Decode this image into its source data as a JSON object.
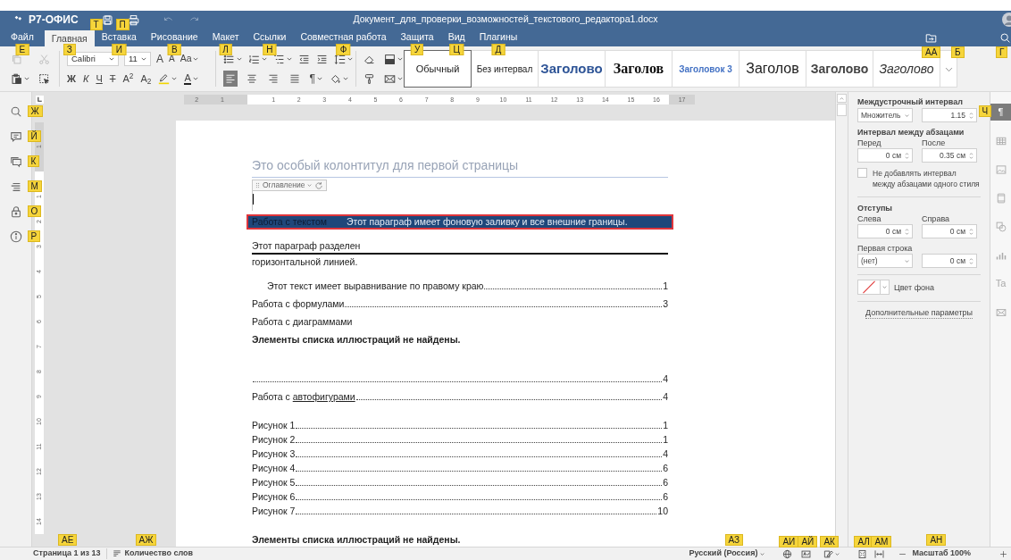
{
  "header": {
    "app_name": "Р7-ОФИС",
    "title": "Документ_для_проверки_возможностей_текстового_редактора1.docx",
    "quick_actions": [
      {
        "kind": "save",
        "hint": "Т",
        "disabled": false
      },
      {
        "kind": "print",
        "hint": "П",
        "disabled": false
      },
      {
        "kind": "undo",
        "disabled": true
      },
      {
        "kind": "redo",
        "disabled": true
      }
    ]
  },
  "tabs": [
    {
      "label": "Файл",
      "selected": false,
      "hint": "Е"
    },
    {
      "label": "Главная",
      "selected": true,
      "hint": "З"
    },
    {
      "label": "Вставка",
      "selected": false,
      "hint": "И"
    },
    {
      "label": "Рисование",
      "selected": false,
      "hint": "В"
    },
    {
      "label": "Макет",
      "selected": false,
      "hint": "Л"
    },
    {
      "label": "Ссылки",
      "selected": false,
      "hint": "Н"
    },
    {
      "label": "Совместная работа",
      "selected": false,
      "hint": "Ф"
    },
    {
      "label": "Защита",
      "selected": false,
      "hint": "У"
    },
    {
      "label": "Вид",
      "selected": false,
      "hint": "Ц"
    },
    {
      "label": "Плагины",
      "selected": false,
      "hint": "Д"
    }
  ],
  "header_actions": [
    {
      "kind": "open-location",
      "hint": "АА"
    },
    {
      "kind": "blank",
      "hint": "Б"
    },
    {
      "kind": "search",
      "hint": "Г"
    }
  ],
  "toolbar": {
    "clipboard": [
      {
        "kind": "copy",
        "disabled": true
      },
      {
        "kind": "cut",
        "disabled": true
      },
      {
        "kind": "paste",
        "disabled": false
      },
      {
        "kind": "select-all",
        "disabled": false
      }
    ],
    "font": "Calibri",
    "size": "11",
    "font_buttons": [
      {
        "kind": "grow",
        "label": "A"
      },
      {
        "kind": "shrink",
        "label": "A"
      },
      {
        "kind": "case",
        "label": "Aa"
      }
    ],
    "format_buttons": [
      {
        "kind": "bold",
        "label": "Ж"
      },
      {
        "kind": "italic",
        "label": "К"
      },
      {
        "kind": "underline",
        "label": "Ч"
      },
      {
        "kind": "strike",
        "label": "Т"
      },
      {
        "kind": "superscript",
        "label": "A$^{2}$"
      },
      {
        "kind": "subscript",
        "label": "A$_{2}$"
      },
      {
        "kind": "highlight"
      },
      {
        "kind": "font-color",
        "label": "A"
      }
    ],
    "alignment": [
      {
        "kind": "left",
        "selected": true
      },
      {
        "kind": "center",
        "selected": false
      },
      {
        "kind": "right",
        "selected": false
      },
      {
        "kind": "justify",
        "selected": false
      }
    ],
    "paragraph_mark": "¶",
    "styles": [
      {
        "label": "Обычный",
        "kind": "normal",
        "selected": true
      },
      {
        "label": "Без интервал",
        "kind": "no-spacing",
        "selected": false
      },
      {
        "label": "Заголово",
        "kind": "heading1",
        "selected": false
      },
      {
        "label": "Заголов",
        "kind": "heading2",
        "selected": false
      },
      {
        "label": "Заголовок 3",
        "kind": "heading3",
        "selected": false
      },
      {
        "label": "Заголов",
        "kind": "title",
        "selected": false
      },
      {
        "label": "Заголово",
        "kind": "subtitle",
        "selected": false
      },
      {
        "label": "Заголово",
        "kind": "quote",
        "selected": false
      }
    ]
  },
  "left_panel": [
    {
      "kind": "search",
      "hint": "Ж"
    },
    {
      "kind": "comments",
      "hint": "Й"
    },
    {
      "kind": "chat",
      "hint": "К"
    },
    {
      "kind": "navigation",
      "hint": "М"
    },
    {
      "kind": "protection",
      "hint": "О"
    },
    {
      "kind": "info",
      "hint": "Р"
    }
  ],
  "ruler": {
    "horizontal": [
      "2",
      "1",
      "1",
      "2",
      "3",
      "4",
      "5",
      "6",
      "7",
      "8",
      "9",
      "10",
      "11",
      "12",
      "13",
      "14",
      "15",
      "16",
      "17"
    ],
    "vertical": [
      "1",
      "1",
      "2",
      "3",
      "4",
      "5",
      "6",
      "7",
      "8",
      "9",
      "10",
      "11",
      "12",
      "13",
      "14"
    ]
  },
  "document": {
    "header_text": "Это особый колонтитул для первой страницы",
    "toc_control": "Оглавление",
    "blocks": [
      {
        "kind": "shaded",
        "label": "Работа с текстом",
        "text": "Этот параграф имеет фоновую заливку и все внешние границы."
      },
      {
        "kind": "divided",
        "before": "Этот параграф разделен",
        "after": "горизонтальной линией."
      },
      {
        "kind": "toc-sub",
        "title": "Этот текст имеет выравнивание по правому краю",
        "page": "1"
      },
      {
        "kind": "toc",
        "title": "Работа с формулами",
        "page": "3"
      },
      {
        "kind": "plain",
        "text": "Работа с диаграммами"
      },
      {
        "kind": "bold",
        "text": "Элементы списка иллюстраций не найдены."
      },
      {
        "kind": "toc",
        "page": "4"
      },
      {
        "kind": "toc",
        "title": "Работа с ",
        "link": "автофигурами",
        "page": "4"
      },
      {
        "kind": "figures",
        "items": [
          {
            "title": "Рисунок 1",
            "page": "1"
          },
          {
            "title": "Рисунок 2",
            "page": "1"
          },
          {
            "title": "Рисунок 3",
            "page": "4"
          },
          {
            "title": "Рисунок 4",
            "page": "6"
          },
          {
            "title": "Рисунок 5",
            "page": "6"
          },
          {
            "title": "Рисунок 6",
            "page": "6"
          },
          {
            "title": "Рисунок 7",
            "page": "10"
          }
        ]
      },
      {
        "kind": "bold",
        "text": "Элементы списка иллюстраций не найдены."
      }
    ]
  },
  "right_panel": {
    "line_spacing": {
      "heading": "Междустрочный интервал",
      "mode": "Множитель",
      "value": "1.15"
    },
    "paragraph_spacing": {
      "heading": "Интервал между абзацами",
      "before_label": "Перед",
      "before": "0 см",
      "after_label": "После",
      "after": "0.35 см"
    },
    "no_spacing_same_style": {
      "label": "Не добавлять интервал между абзацами одного стиля",
      "checked": false
    },
    "indents": {
      "heading": "Отступы",
      "left_label": "Слева",
      "left": "0 см",
      "right_label": "Справа",
      "right": "0 см",
      "first_line_label": "Первая строка",
      "first_line_mode": "(нет)",
      "first_line": "0 см"
    },
    "background_label": "Цвет фона",
    "advanced_link": "Дополнительные параметры"
  },
  "right_tabs": [
    {
      "kind": "paragraph",
      "label": "¶",
      "selected": true,
      "hint": "Ч"
    },
    {
      "kind": "table",
      "selected": false
    },
    {
      "kind": "image",
      "selected": false
    },
    {
      "kind": "header",
      "selected": false
    },
    {
      "kind": "shape",
      "selected": false
    },
    {
      "kind": "chart",
      "selected": false
    },
    {
      "kind": "textart",
      "label": "Ta",
      "selected": false
    },
    {
      "kind": "mail",
      "selected": false
    }
  ],
  "status_bar": {
    "page": {
      "text": "Страница 1 из 13",
      "hint": "АЕ"
    },
    "word_count": {
      "text": "Количество слов",
      "hint": "АЖ"
    },
    "language": {
      "text": "Русский (Россия)",
      "hint": "АЗ"
    },
    "tools": [
      {
        "kind": "globe",
        "hint": "АИ"
      },
      {
        "kind": "spellcheck",
        "hint": "АЙ"
      },
      {
        "kind": "track-changes",
        "hint": "АК"
      },
      {
        "kind": "fit-page",
        "hint": "АЛ"
      },
      {
        "kind": "fit-width",
        "hint": "АМ"
      }
    ],
    "zoom": {
      "text": "Масштаб 100%",
      "hint": "АН"
    }
  }
}
